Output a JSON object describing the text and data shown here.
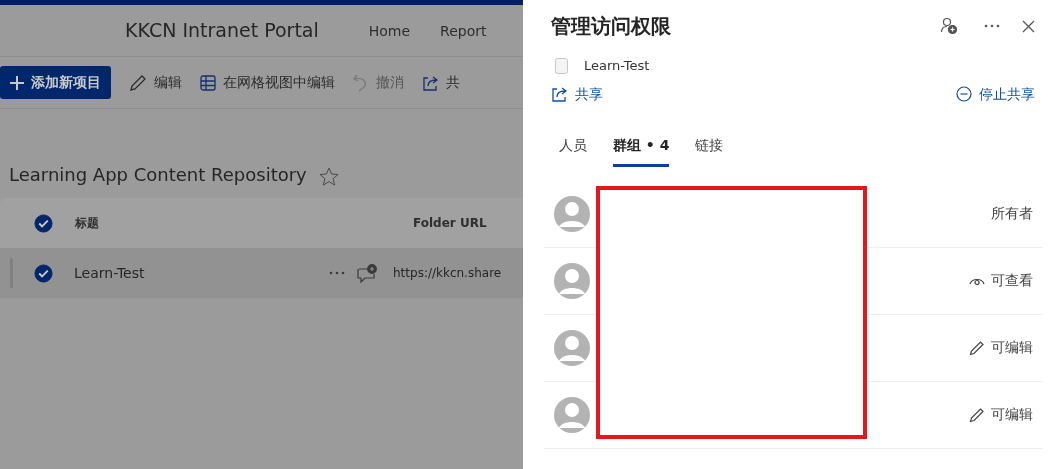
{
  "site": {
    "title": "KKCN Intranet Portal",
    "nav": [
      "Home",
      "Report"
    ]
  },
  "command_bar": [
    {
      "kind": "primary",
      "label": "添加新项目",
      "disabled": false
    },
    {
      "kind": "edit",
      "label": "编辑",
      "disabled": false
    },
    {
      "kind": "grid",
      "label": "在网格视图中编辑",
      "disabled": false
    },
    {
      "kind": "undo",
      "label": "撤消",
      "disabled": true
    },
    {
      "kind": "share",
      "label": "共",
      "disabled": false
    }
  ],
  "list": {
    "title": "Learning App Content Repository",
    "favorite": false,
    "columns": [
      {
        "label": "标题"
      },
      {
        "label": "Folder URL"
      }
    ],
    "all_selected": true,
    "rows": [
      {
        "title": "Learn-Test",
        "url": "https://kkcn.share",
        "selected": true
      }
    ]
  },
  "panel": {
    "title": "管理访问权限",
    "item": "Learn-Test",
    "share": "共享",
    "stop_share": "停止共享",
    "tabs": [
      {
        "label": "人员",
        "selected": false
      },
      {
        "label": "群组 • 4",
        "selected": true
      },
      {
        "label": "链接",
        "selected": false
      }
    ],
    "members": [
      {
        "permission": "所有者",
        "kind": "owner"
      },
      {
        "permission": "可查看",
        "kind": "view"
      },
      {
        "permission": "可编辑",
        "kind": "edit"
      },
      {
        "permission": "可编辑",
        "kind": "edit"
      }
    ]
  }
}
